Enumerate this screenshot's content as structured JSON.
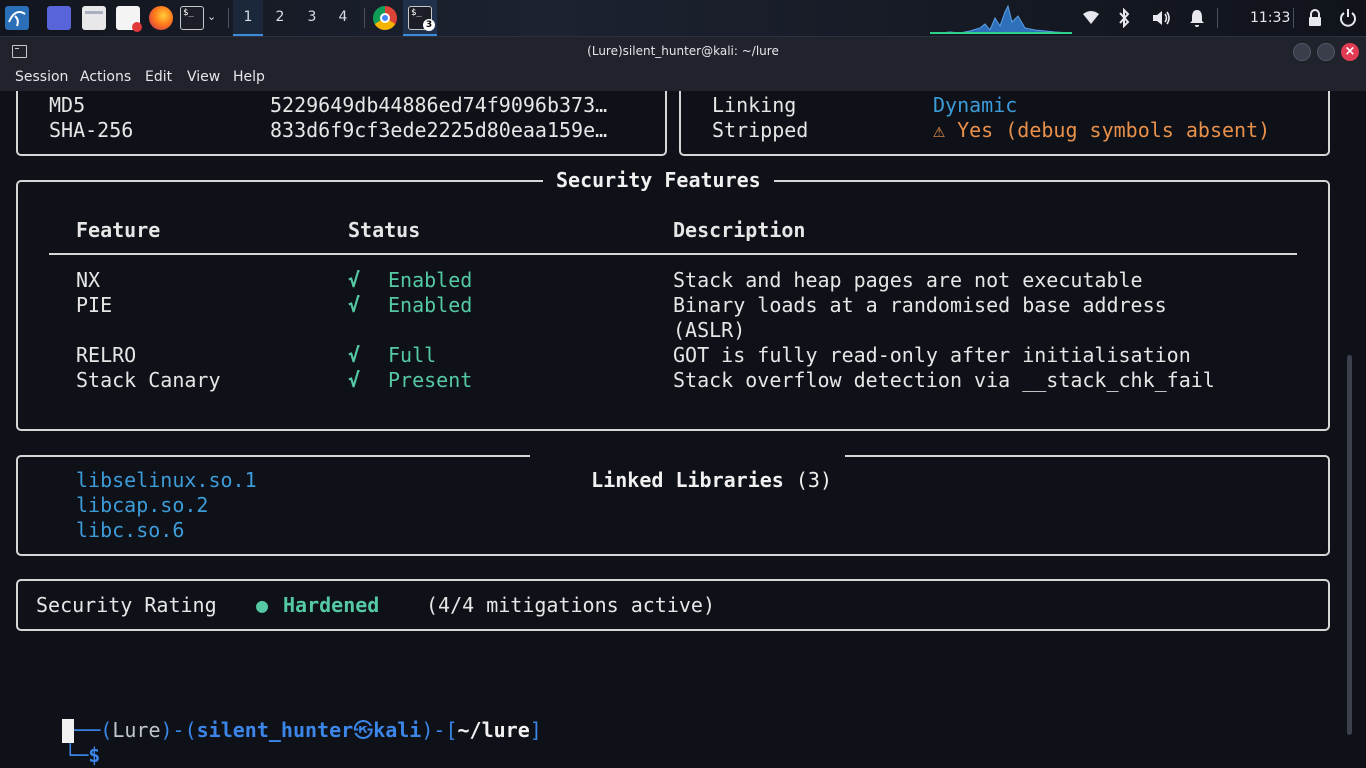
{
  "taskbar": {
    "workspaces": [
      "1",
      "2",
      "3",
      "4"
    ],
    "active_workspace": "1",
    "terminal_badge": "3",
    "clock": "11:33",
    "icons": [
      "kali-menu-icon",
      "desktop-icon",
      "files-icon",
      "text-editor-icon",
      "firefox-icon",
      "terminal-icon",
      "chrome-icon",
      "terminal-active-icon",
      "wifi-icon",
      "bluetooth-icon",
      "volume-icon",
      "bell-icon",
      "lock-icon",
      "power-icon"
    ]
  },
  "window": {
    "title": "(Lure)silent_hunter@kali: ~/lure",
    "menu": [
      "Session",
      "Actions",
      "Edit",
      "View",
      "Help"
    ]
  },
  "hashes": {
    "rows": [
      {
        "key": "MD5",
        "value": "5229649db44886ed74f9096b373…"
      },
      {
        "key": "SHA-256",
        "value": "833d6f9cf3ede2225d80eaa159e…"
      }
    ]
  },
  "binary_info": {
    "rows": [
      {
        "key": "Linking",
        "value": "Dynamic"
      },
      {
        "key": "Stripped",
        "value": "⚠ Yes (debug symbols absent)"
      }
    ]
  },
  "security": {
    "title": "Security Features",
    "headers": {
      "feature": "Feature",
      "status": "Status",
      "description": "Description"
    },
    "rows": [
      {
        "feature": "NX",
        "check": "√",
        "status": "Enabled",
        "description": "Stack and heap pages are not executable",
        "description2": ""
      },
      {
        "feature": "PIE",
        "check": "√",
        "status": "Enabled",
        "description": "Binary loads at a randomised base address",
        "description2": "(ASLR)"
      },
      {
        "feature": "RELRO",
        "check": "√",
        "status": "Full",
        "description": "GOT is fully read-only after initialisation",
        "description2": ""
      },
      {
        "feature": "Stack Canary",
        "check": "√",
        "status": "Present",
        "description": "Stack overflow detection via __stack_chk_fail",
        "description2": ""
      }
    ]
  },
  "libraries": {
    "title": "Linked Libraries",
    "count": "(3)",
    "items": [
      "libselinux.so.1",
      "libcap.so.2",
      "libc.so.6"
    ]
  },
  "rating": {
    "label": "Security Rating",
    "bullet": "●",
    "value": "Hardened",
    "detail": "(4/4 mitigations active)"
  },
  "prompt": {
    "line1_prefix": "┌──(",
    "venv": "Lure",
    "mid1": ")-(",
    "user": "silent_hunter",
    "at": "㉿",
    "host": "kali",
    "mid2": ")-[",
    "path": "~/lure",
    "end": "]",
    "line2_prefix": "└─",
    "symbol": "$"
  },
  "colors": {
    "accent_green": "#54c9a4",
    "link_blue": "#3d9bd8",
    "warning_orange": "#e9904a",
    "prompt_blue": "#3b86e8",
    "close_red": "#e23b54"
  }
}
